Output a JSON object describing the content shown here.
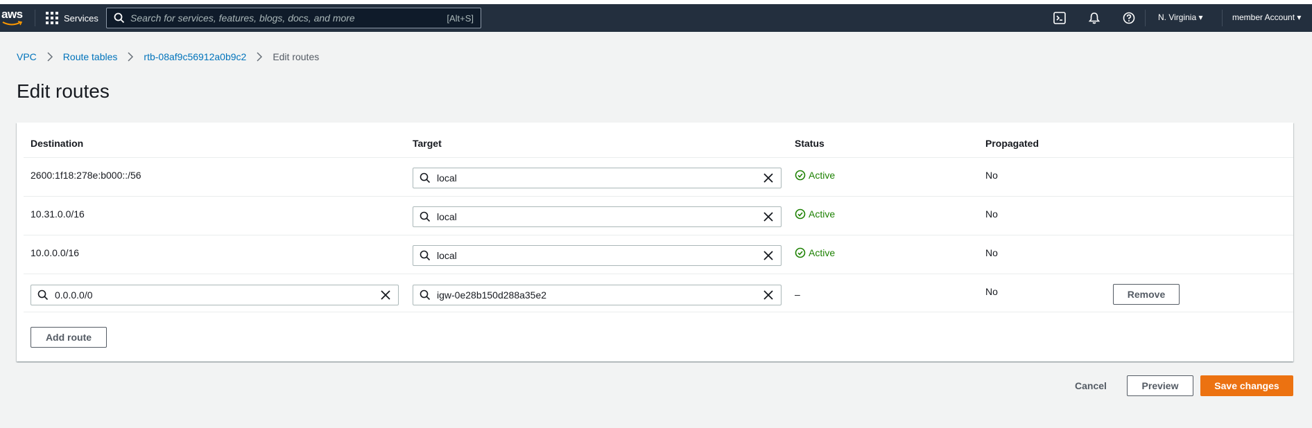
{
  "topnav": {
    "logo_text": "aws",
    "services_label": "Services",
    "search_placeholder": "Search for services, features, blogs, docs, and more",
    "search_shortcut": "[Alt+S]",
    "region": "N. Virginia ▾",
    "account": "member Account ▾",
    "colors": {
      "background": "#232f3e",
      "accent": "#ec7211"
    }
  },
  "breadcrumb": {
    "items": [
      "VPC",
      "Route tables",
      "rtb-08af9c56912a0b9c2"
    ],
    "current": "Edit routes"
  },
  "page": {
    "title": "Edit routes"
  },
  "routes": {
    "headers": {
      "destination": "Destination",
      "target": "Target",
      "status": "Status",
      "propagated": "Propagated"
    },
    "rows": [
      {
        "destination": "2600:1f18:278e:b000::/56",
        "target": "local",
        "status": "Active",
        "propagated": "No"
      },
      {
        "destination": "10.31.0.0/16",
        "target": "local",
        "status": "Active",
        "propagated": "No"
      },
      {
        "destination": "10.0.0.0/16",
        "target": "local",
        "status": "Active",
        "propagated": "No"
      },
      {
        "destination": "0.0.0.0/0",
        "target": "igw-0e28b150d288a35e2",
        "status": "–",
        "propagated": "No",
        "remove_label": "Remove"
      }
    ],
    "add_route_label": "Add route"
  },
  "footer": {
    "cancel_label": "Cancel",
    "preview_label": "Preview",
    "save_label": "Save changes"
  }
}
